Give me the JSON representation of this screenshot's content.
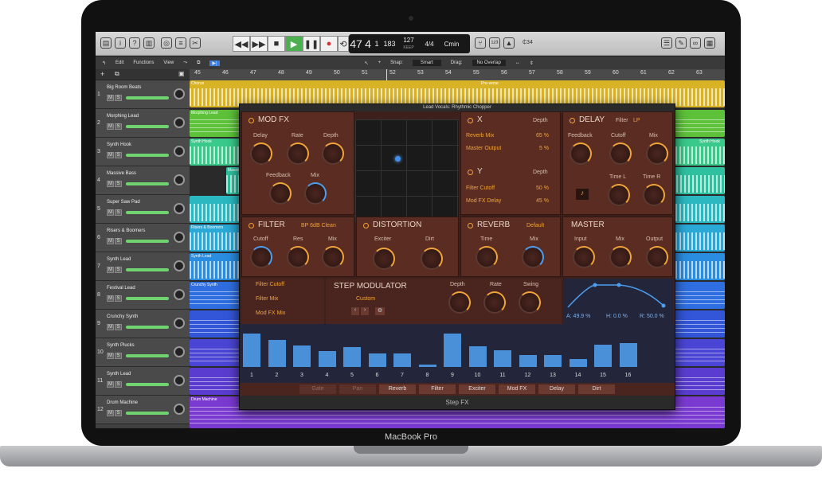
{
  "device": {
    "label": "MacBook Pro"
  },
  "transport": {
    "bar": "47",
    "beat": "4",
    "div": "1",
    "tick": "183",
    "tempo": "127",
    "tempo_mode": "KEEP",
    "sig": "4/4",
    "key": "Cmin",
    "bar_lbl": "BAR",
    "beat_lbl": "BEAT",
    "div_lbl": "DIV",
    "tick_lbl": "TICK",
    "tempo_lbl": "TEMPO",
    "key_lbl": "KEY",
    "cpu": "₵34"
  },
  "editbar": {
    "edit": "Edit",
    "functions": "Functions",
    "view": "View",
    "snap_label": "Snap:",
    "snap": "Smart",
    "drag_label": "Drag:",
    "drag": "No Overlap"
  },
  "ruler": [
    "45",
    "46",
    "47",
    "48",
    "49",
    "50",
    "51",
    "52",
    "53",
    "54",
    "55",
    "56",
    "57",
    "58",
    "59",
    "60",
    "61",
    "62",
    "63"
  ],
  "tracks": [
    {
      "n": "1",
      "name": "Big Room Beats"
    },
    {
      "n": "2",
      "name": "Morphing Lead"
    },
    {
      "n": "3",
      "name": "Synth Hook"
    },
    {
      "n": "4",
      "name": "Massive Bass"
    },
    {
      "n": "5",
      "name": "Super Saw Pad"
    },
    {
      "n": "6",
      "name": "Risers & Boomers"
    },
    {
      "n": "7",
      "name": "Synth Lead"
    },
    {
      "n": "8",
      "name": "Festival Lead"
    },
    {
      "n": "9",
      "name": "Crunchy Synth"
    },
    {
      "n": "10",
      "name": "Synth Plucks"
    },
    {
      "n": "11",
      "name": "Synth Lead"
    },
    {
      "n": "12",
      "name": "Drum Machine"
    }
  ],
  "track_ms": {
    "m": "M",
    "s": "S"
  },
  "regions": {
    "chorus": "Chorus",
    "preverse": "Pre-verse",
    "morph": "Morphing Lead",
    "hook": "Synth Hook",
    "hook2": "Synth Hook",
    "massive": "Massive",
    "risers": "Risers & Boomers",
    "slead": "Synth Lead",
    "crunchy": "Crunchy Synth",
    "drum": "Drum Machine"
  },
  "plugin": {
    "title": "Lead Vocals: Rhythmic Chopper",
    "footer": "Step FX",
    "modfx": {
      "title": "MOD FX",
      "delay": "Delay",
      "rate": "Rate",
      "depth": "Depth",
      "feedback": "Feedback",
      "mix": "Mix"
    },
    "x": {
      "title": "X",
      "depth": "Depth",
      "r1": "Reverb Mix",
      "v1": "65 %",
      "r2": "Master Output",
      "v2": "5 %"
    },
    "y": {
      "title": "Y",
      "depth": "Depth",
      "r1": "Filter Cutoff",
      "v1": "50 %",
      "r2": "Mod FX Delay",
      "v2": "45 %"
    },
    "delay": {
      "title": "DELAY",
      "filter": "Filter",
      "filter_val": "LP",
      "feedback": "Feedback",
      "cutoff": "Cutoff",
      "mix": "Mix",
      "timel": "Time L",
      "timer": "Time R",
      "note": "♪"
    },
    "filter": {
      "title": "FILTER",
      "type": "BP 6dB Clean",
      "cutoff": "Cutoff",
      "res": "Res",
      "mix": "Mix"
    },
    "distortion": {
      "title": "DISTORTION",
      "exciter": "Exciter",
      "dirt": "Dirt"
    },
    "reverb": {
      "title": "REVERB",
      "type": "Default",
      "time": "Time",
      "mix": "Mix"
    },
    "master": {
      "title": "MASTER",
      "input": "Input",
      "mix": "Mix",
      "output": "Output"
    },
    "targets": [
      "Filter Cutoff",
      "Filter Mix",
      "Mod FX Mix"
    ],
    "stepmod": {
      "title": "STEP MODULATOR",
      "preset": "Custom",
      "depth": "Depth",
      "rate": "Rate",
      "swing": "Swing",
      "a": "A: 49.9 %",
      "h": "H: 0.0 %",
      "r": "R: 50.0 %"
    },
    "steps": {
      "labels": [
        "1",
        "2",
        "3",
        "4",
        "5",
        "6",
        "7",
        "8",
        "9",
        "10",
        "11",
        "12",
        "13",
        "14",
        "15",
        "16"
      ],
      "values": [
        0.8,
        0.65,
        0.52,
        0.38,
        0.48,
        0.32,
        0.32,
        0.06,
        0.8,
        0.5,
        0.4,
        0.28,
        0.28,
        0.2,
        0.54,
        0.58
      ]
    },
    "tabs": [
      "Gate",
      "Pan",
      "Reverb",
      "Filter",
      "Exciter",
      "Mod FX",
      "Delay",
      "Dirt"
    ]
  }
}
